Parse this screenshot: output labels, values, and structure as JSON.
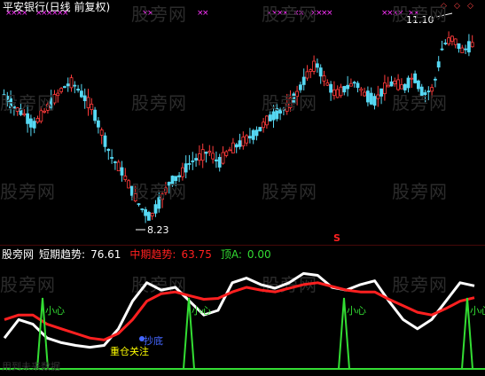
{
  "header": {
    "title": "平安银行(日线 前复权)"
  },
  "watermark": "股旁网",
  "colors": {
    "up": "#ff3b3b",
    "down": "#56d8f3",
    "magenta": "#ff33ff",
    "white": "#ffffff",
    "red": "#ff2020",
    "green": "#33dd33",
    "yellow": "#ffff00",
    "blue": "#4466ff"
  },
  "main": {
    "high_label": "11.10",
    "low_label": "8.23",
    "signal_mark": "S"
  },
  "indicator": {
    "name": "股旁网",
    "short_label": "短期趋势:",
    "short_value": "76.61",
    "mid_label": "中期趋势:",
    "mid_value": "63.75",
    "top_label": "顶A:",
    "top_value": "0.00",
    "caution": "小心",
    "bottom": "抄底",
    "focus": "重仓关注"
  },
  "footer": "用到未来数据",
  "chart_data": {
    "type": "line",
    "price_axis": [
      8.0,
      11.5
    ],
    "price_path": [
      10.2,
      10.0,
      9.9,
      9.7,
      9.9,
      10.1,
      10.3,
      10.4,
      10.2,
      10.0,
      9.6,
      9.2,
      9.0,
      8.7,
      8.4,
      8.23,
      8.5,
      8.8,
      8.9,
      9.1,
      9.2,
      9.3,
      9.1,
      9.3,
      9.4,
      9.5,
      9.6,
      9.8,
      9.9,
      10.0,
      10.2,
      10.5,
      10.7,
      10.4,
      10.2,
      10.3,
      10.4,
      10.2,
      10.1,
      10.3,
      10.4,
      10.3,
      10.5,
      10.2,
      10.3,
      11.0,
      11.1,
      10.9,
      11.0
    ],
    "series": [
      {
        "name": "短期趋势",
        "values": [
          20,
          40,
          35,
          20,
          15,
          12,
          10,
          12,
          30,
          60,
          80,
          72,
          75,
          60,
          45,
          50,
          80,
          85,
          78,
          74,
          80,
          90,
          88,
          75,
          72,
          78,
          82,
          60,
          40,
          30,
          40,
          60,
          80,
          76.61
        ]
      },
      {
        "name": "中期趋势",
        "values": [
          40,
          45,
          45,
          35,
          30,
          25,
          20,
          18,
          25,
          40,
          60,
          68,
          70,
          66,
          62,
          63,
          70,
          75,
          72,
          70,
          74,
          78,
          80,
          76,
          72,
          70,
          70,
          62,
          55,
          48,
          45,
          52,
          60,
          63.75
        ]
      }
    ],
    "ylim": [
      0,
      100
    ]
  }
}
